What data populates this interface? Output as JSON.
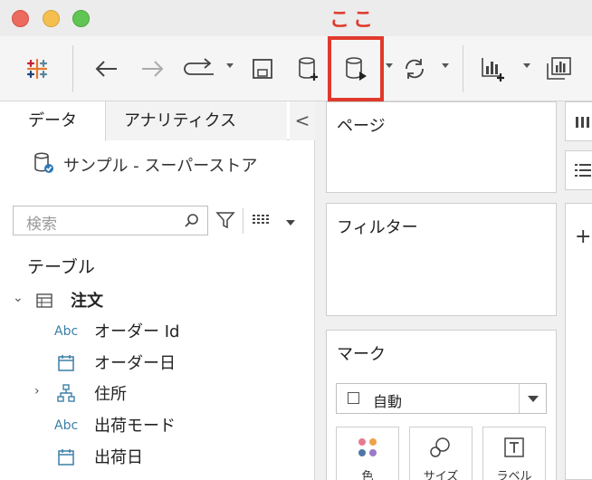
{
  "annotation": {
    "label": "ここ",
    "color": "#e03a2c"
  },
  "toolbar": {
    "items": [
      "tableau-logo",
      "back",
      "forward",
      "redo",
      "save",
      "new-data-source",
      "run-data",
      "refresh",
      "new-worksheet",
      "show-me"
    ]
  },
  "data_pane": {
    "tabs": {
      "data": "データ",
      "analytics": "アナリティクス"
    },
    "collapse_glyph": "<",
    "data_source": "サンプル - スーパーストア",
    "search": {
      "placeholder": "検索",
      "value": ""
    },
    "tables_header": "テーブル",
    "table": {
      "name": "注文",
      "fields": [
        {
          "type_label": "Abc",
          "name": "オーダー Id"
        },
        {
          "type_label": "",
          "name": "オーダー日"
        },
        {
          "type_label": "",
          "name": "住所"
        },
        {
          "type_label": "Abc",
          "name": "出荷モード"
        },
        {
          "type_label": "",
          "name": "出荷日"
        }
      ]
    }
  },
  "shelves": {
    "pages": "ページ",
    "filters": "フィルター",
    "marks": {
      "title": "マーク",
      "type": "自動",
      "buttons": [
        {
          "label": "色"
        },
        {
          "label": "サイズ"
        },
        {
          "label": "ラベル"
        }
      ]
    }
  },
  "colors": {
    "accent": "#3c7fa6",
    "highlight": "#e03a2c"
  }
}
